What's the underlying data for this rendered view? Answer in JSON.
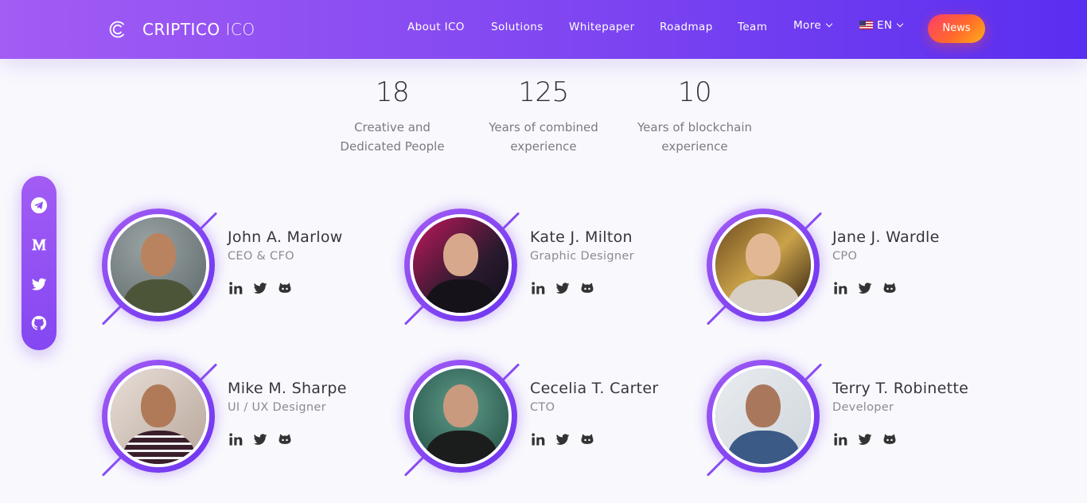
{
  "header": {
    "logo_name": "CRIPTICO",
    "logo_suffix": "ICO",
    "nav": [
      {
        "label": "About ICO"
      },
      {
        "label": "Solutions"
      },
      {
        "label": "Whitepaper"
      },
      {
        "label": "Roadmap"
      },
      {
        "label": "Team"
      },
      {
        "label": "More"
      },
      {
        "label": "EN"
      }
    ],
    "news_button": "News"
  },
  "stats": [
    {
      "value": "18",
      "label_line1": "Creative and",
      "label_line2": "Dedicated People"
    },
    {
      "value": "125",
      "label_line1": "Years of combined",
      "label_line2": "experience"
    },
    {
      "value": "10",
      "label_line1": "Years of blockchain",
      "label_line2": "experience"
    }
  ],
  "social_sidebar": {
    "icons": [
      "telegram-icon",
      "medium-icon",
      "twitter-icon",
      "github-icon"
    ],
    "color": "#ffffff"
  },
  "team": [
    {
      "name": "John A. Marlow",
      "role": "CEO & CFO"
    },
    {
      "name": "Kate J. Milton",
      "role": "Graphic Designer"
    },
    {
      "name": "Jane J. Wardle",
      "role": "CPO"
    },
    {
      "name": "Mike M. Sharpe",
      "role": "UI / UX Designer"
    },
    {
      "name": "Cecelia T. Carter",
      "role": "CTO"
    },
    {
      "name": "Terry T. Robinette",
      "role": "Developer"
    }
  ],
  "member_links": [
    "linkedin-icon",
    "twitter-icon",
    "github-icon"
  ],
  "colors": {
    "header_gradient_start": "#a35cf4",
    "header_gradient_end": "#5a2ef0",
    "accent": "#8a4cf3",
    "news_gradient": [
      "#ff3d6a",
      "#ff6a2b",
      "#ffb017"
    ]
  }
}
